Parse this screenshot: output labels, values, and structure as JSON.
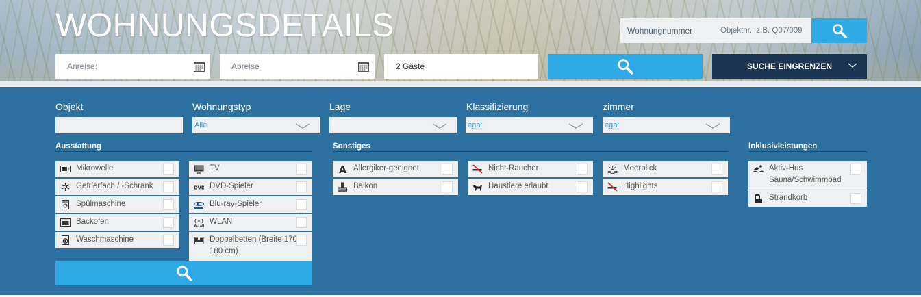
{
  "header": {
    "title": "WOHNUNGSDETAILS",
    "apartment_search_label": "Wohnungnummer",
    "apartment_search_placeholder": "Objektnr.: z.B. Q07/009",
    "arrival_placeholder": "Anreise:",
    "departure_placeholder": "Abreise",
    "guests_value": "2 Gäste",
    "refine_label": "SUCHE EINGRENZEN"
  },
  "filters": {
    "objekt_label": "Objekt",
    "objekt_value": "",
    "wohnungstyp_label": "Wohnungstyp",
    "wohnungstyp_value": "Alle",
    "lage_label": "Lage",
    "lage_value": "",
    "klassifizierung_label": "Klassifizierung",
    "klassifizierung_value": "egal",
    "zimmer_label": "zimmer",
    "zimmer_value": "egal"
  },
  "ausstattung": {
    "title": "Ausstattung",
    "col1": [
      "Mikrowelle",
      "Gefrierfach / -Schrank",
      "Spülmaschine",
      "Backofen",
      "Waschmaschine"
    ],
    "col2": [
      "TV",
      "DVD-Spieler",
      "Blu-ray-Spieler",
      "WLAN",
      "Doppelbetten (Breite 170-180 cm)"
    ]
  },
  "sonstiges": {
    "title": "Sonstiges",
    "col1": [
      "Allergiker-geeignet",
      "Balkon"
    ],
    "col2": [
      "Nicht-Raucher",
      "Haustiere erlaubt"
    ],
    "col3": [
      "Meerblick",
      "Highlights"
    ]
  },
  "inklusiv": {
    "title": "Inklusivleistungen",
    "items": [
      "Aktiv-Hus Sauna/Schwimmbad",
      "Strandkorb"
    ]
  },
  "colors": {
    "accent": "#2fa9e3",
    "panel": "#2d71a0",
    "dark": "#1b3552"
  },
  "icons": {
    "search": "search-icon",
    "calendar": "calendar-icon",
    "chevron": "chevron-down-icon"
  }
}
